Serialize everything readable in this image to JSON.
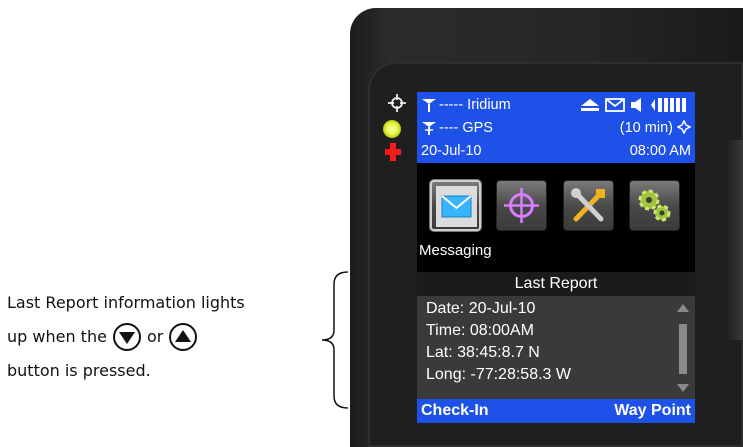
{
  "annotation": {
    "line1": "Last Report information lights",
    "line2_prefix": "up when the",
    "line2_or": "or",
    "line3": "button is pressed.",
    "down_button_icon": "down-triangle-icon",
    "up_button_icon": "up-triangle-icon"
  },
  "device": {
    "leds": [
      "gps-crosshair-icon",
      "yellow-status-led",
      "red-cross-icon"
    ]
  },
  "screen": {
    "status": {
      "iridium_label": "----- Iridium",
      "gps_label": "----  GPS",
      "interval": "(10 min)",
      "date": "20-Jul-10",
      "time": "08:00 AM",
      "icons": [
        "eject-icon",
        "envelope-icon",
        "speaker-icon",
        "battery-bars-icon",
        "gps-fix-icon"
      ]
    },
    "apps": [
      {
        "name": "Messaging",
        "icon": "envelope-icon"
      },
      {
        "name": "Tracking",
        "icon": "crosshair-icon"
      },
      {
        "name": "Tools",
        "icon": "tools-icon"
      },
      {
        "name": "Settings",
        "icon": "gears-icon"
      }
    ],
    "selected_app_label": "Messaging",
    "last_report": {
      "title": "Last Report",
      "date": "Date: 20-Jul-10",
      "time": "Time: 08:00AM",
      "lat": "Lat: 38:45:8.7 N",
      "long": "Long: -77:28:58.3 W"
    },
    "softkeys": {
      "left": "Check-In",
      "right": "Way Point"
    }
  },
  "colors": {
    "status_blue": "#1e51e8",
    "led_yellow": "#e6f542",
    "led_red": "#ff1a1a"
  }
}
